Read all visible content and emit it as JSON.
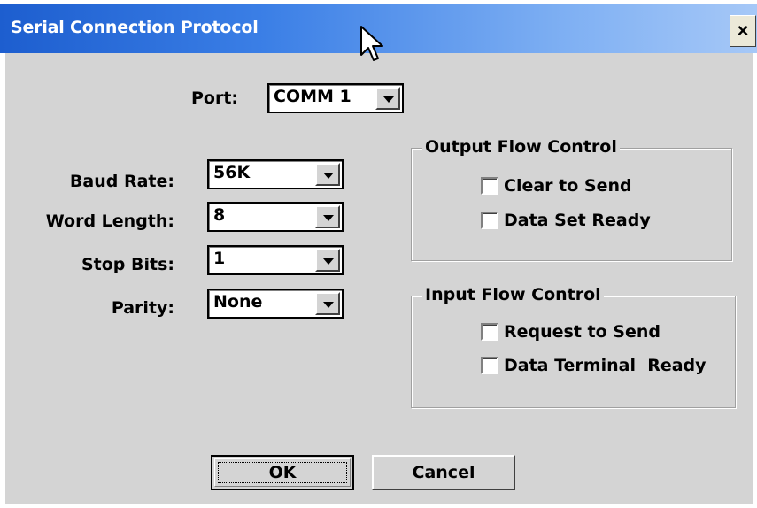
{
  "window": {
    "title": "Serial Connection Protocol",
    "close_glyph": "×"
  },
  "port": {
    "label": "Port:",
    "value": "COMM 1"
  },
  "settings": [
    {
      "label": "Baud Rate:",
      "value": "56K"
    },
    {
      "label": "Word Length:",
      "value": "8"
    },
    {
      "label": "Stop Bits:",
      "value": "1"
    },
    {
      "label": "Parity:",
      "value": "None"
    }
  ],
  "output_flow": {
    "title": "Output Flow Control",
    "options": [
      {
        "label": "Clear to Send",
        "checked": false
      },
      {
        "label": "Data Set Ready",
        "checked": false
      }
    ]
  },
  "input_flow": {
    "title": "Input Flow Control",
    "options": [
      {
        "label": "Request to Send",
        "checked": false
      },
      {
        "label": "Data Terminal  Ready",
        "checked": false
      }
    ]
  },
  "buttons": {
    "ok": "OK",
    "cancel": "Cancel"
  },
  "icons": {
    "cursor": "arrow-cursor-icon",
    "dropdown": "chevron-down-icon",
    "close": "close-icon"
  }
}
